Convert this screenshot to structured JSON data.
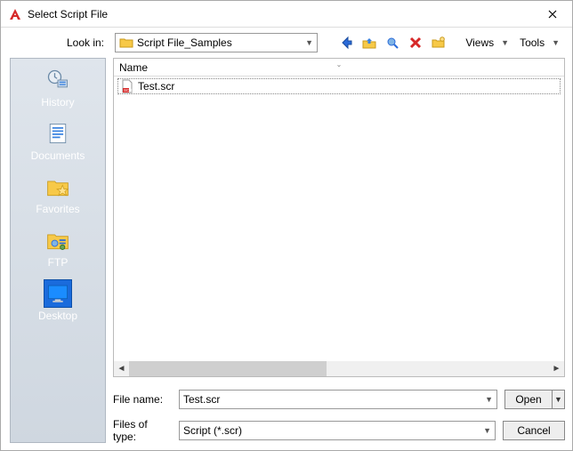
{
  "window": {
    "title": "Select Script File"
  },
  "lookin": {
    "label": "Look in:",
    "value": "Script File_Samples"
  },
  "toolbar": {
    "views": "Views",
    "tools": "Tools"
  },
  "places": [
    {
      "label": "History"
    },
    {
      "label": "Documents"
    },
    {
      "label": "Favorites"
    },
    {
      "label": "FTP"
    },
    {
      "label": "Desktop"
    }
  ],
  "columns": {
    "name": "Name"
  },
  "files": [
    {
      "name": "Test.scr"
    }
  ],
  "form": {
    "filename_label": "File name:",
    "filename_value": "Test.scr",
    "filetype_label": "Files of type:",
    "filetype_value": "Script (*.scr)",
    "open_label": "Open",
    "cancel_label": "Cancel"
  }
}
